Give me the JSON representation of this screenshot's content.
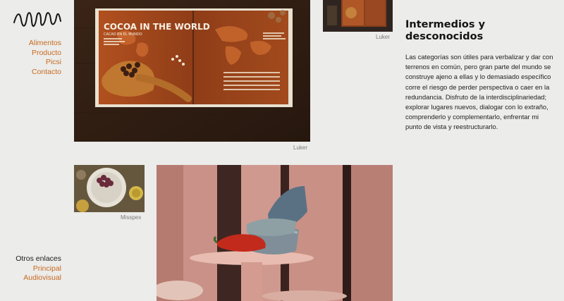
{
  "logo": {
    "icon": "scribble-signature-logo"
  },
  "nav": {
    "items": [
      {
        "label": "Alimentos"
      },
      {
        "label": "Producto"
      },
      {
        "label": "Picsi"
      },
      {
        "label": "Contacto"
      }
    ]
  },
  "other_links": {
    "title": "Otros enlaces",
    "items": [
      {
        "label": "Principal"
      },
      {
        "label": "Audiovisual"
      }
    ]
  },
  "gallery": {
    "cocoa": {
      "caption": "Luker",
      "book_title": "COCOA IN THE WORLD",
      "book_subtitle": "CACAO EN EL MUNDO"
    },
    "small_top": {
      "caption": "Luker"
    },
    "plates": {
      "caption": "Misspex"
    },
    "bowls": {
      "caption": ""
    }
  },
  "article": {
    "title": "Intermedios y desconocidos",
    "body": "Las categorías son útiles para verbalizar y dar con terrenos en común, pero gran parte del mundo se construye ajeno a ellas y lo demasiado específico corre el riesgo de perder perspectiva o caer en la redundancia. Disfruto de la interdisciplinariedad; explorar lugares nuevos, dialogar con lo extraño, comprenderlo y complementarlo, enfrentar mi punto de vista y reestructurarlo."
  },
  "colors": {
    "accent": "#c76a21",
    "background": "#ececea"
  }
}
